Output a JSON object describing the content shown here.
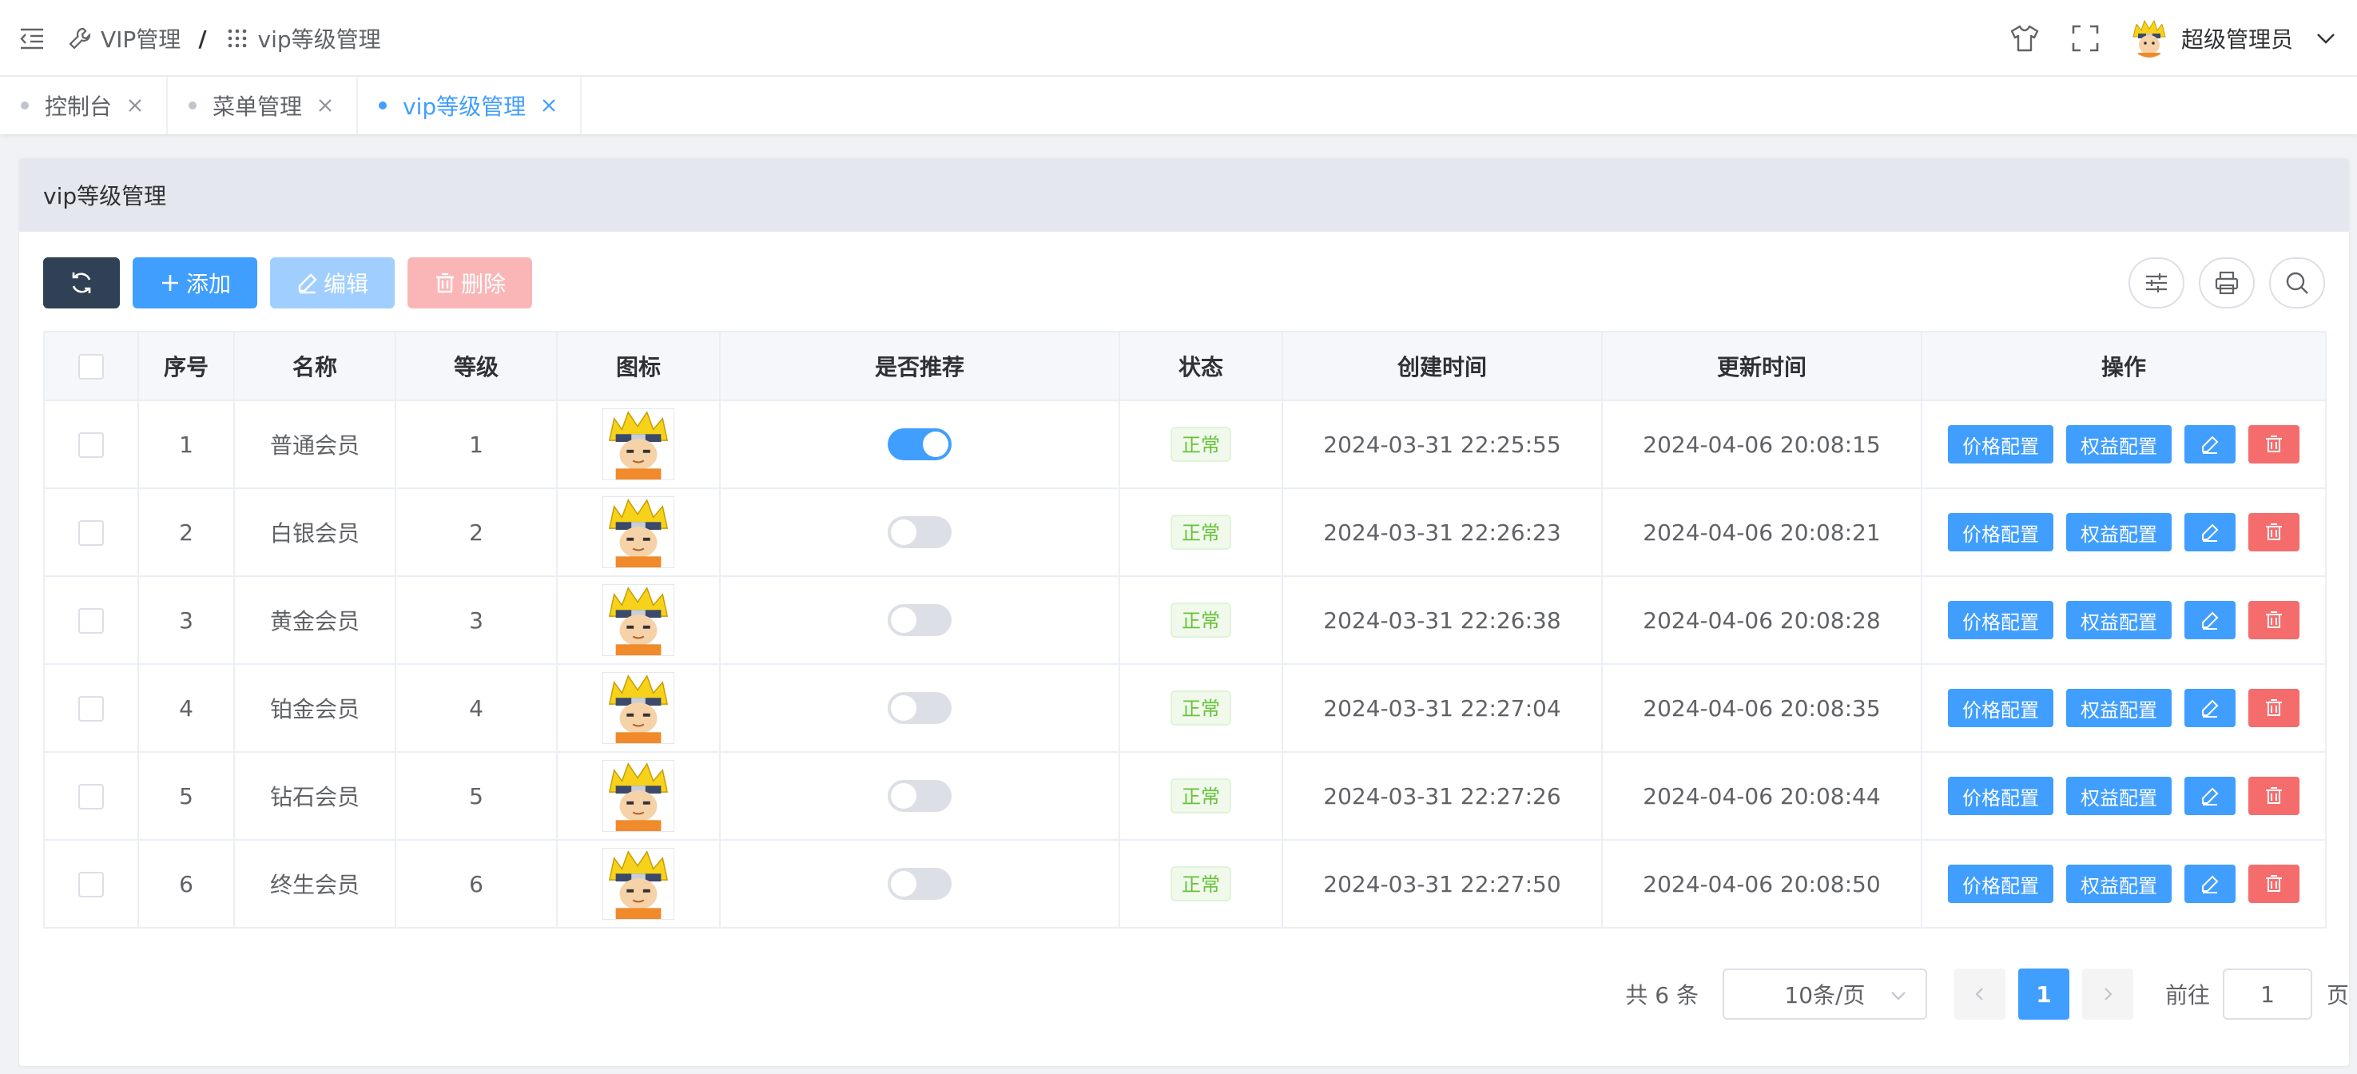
{
  "header": {
    "breadcrumb": [
      "VIP管理",
      "vip等级管理"
    ],
    "breadcrumb_sep": "/",
    "user_name": "超级管理员"
  },
  "tabs": [
    {
      "label": "控制台",
      "active": false
    },
    {
      "label": "菜单管理",
      "active": false
    },
    {
      "label": "vip等级管理",
      "active": true
    }
  ],
  "card": {
    "title": "vip等级管理"
  },
  "toolbar": {
    "add_label": "添加",
    "edit_label": "编辑",
    "delete_label": "删除"
  },
  "table": {
    "columns": [
      "序号",
      "名称",
      "等级",
      "图标",
      "是否推荐",
      "状态",
      "创建时间",
      "更新时间",
      "操作"
    ],
    "rows": [
      {
        "index": "1",
        "name": "普通会员",
        "level": "1",
        "recommended": true,
        "status": "正常",
        "created": "2024-03-31 22:25:55",
        "updated": "2024-04-06 20:08:15"
      },
      {
        "index": "2",
        "name": "白银会员",
        "level": "2",
        "recommended": false,
        "status": "正常",
        "created": "2024-03-31 22:26:23",
        "updated": "2024-04-06 20:08:21"
      },
      {
        "index": "3",
        "name": "黄金会员",
        "level": "3",
        "recommended": false,
        "status": "正常",
        "created": "2024-03-31 22:26:38",
        "updated": "2024-04-06 20:08:28"
      },
      {
        "index": "4",
        "name": "铂金会员",
        "level": "4",
        "recommended": false,
        "status": "正常",
        "created": "2024-03-31 22:27:04",
        "updated": "2024-04-06 20:08:35"
      },
      {
        "index": "5",
        "name": "钻石会员",
        "level": "5",
        "recommended": false,
        "status": "正常",
        "created": "2024-03-31 22:27:26",
        "updated": "2024-04-06 20:08:44"
      },
      {
        "index": "6",
        "name": "终生会员",
        "level": "6",
        "recommended": false,
        "status": "正常",
        "created": "2024-03-31 22:27:50",
        "updated": "2024-04-06 20:08:50"
      }
    ],
    "actions": {
      "price_label": "价格配置",
      "rights_label": "权益配置"
    }
  },
  "pagination": {
    "total_text": "共 6 条",
    "page_size": "10条/页",
    "current_page": "1",
    "goto_label": "前往",
    "goto_value": "1",
    "page_suffix": "页"
  },
  "colors": {
    "primary": "#409eff",
    "danger": "#f56c6c",
    "success": "#67c23a",
    "dark": "#304156"
  },
  "icons": {
    "sidebar_toggle": "outdent-icon",
    "breadcrumb_first": "wrench-icon",
    "breadcrumb_second": "grid-icon",
    "header_right": [
      "shirt-icon",
      "fullscreen-icon"
    ],
    "toolbar_right": [
      "sliders-icon",
      "printer-icon",
      "search-icon"
    ]
  }
}
